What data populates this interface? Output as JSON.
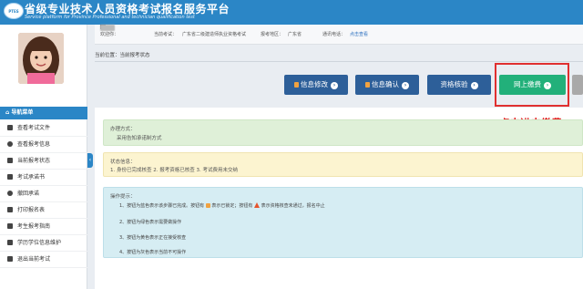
{
  "header": {
    "logo_text": "PTES",
    "title": "省级专业技术人员资格考试报名服务平台",
    "subtitle": "Service platform for Province Professional and technician qualification test"
  },
  "infobar": {
    "welcome": "欢迎你：",
    "current_exam_label": "当前考试：",
    "current_exam": "广东省二级建造师执业资格考试",
    "region_label": "报考地区：",
    "region": "广东省",
    "notice_label": "通讯电话：",
    "notice_link": "点击查看"
  },
  "sidebar": {
    "nav_title": "导航菜单",
    "items": [
      "查看考试文件",
      "查看报考信息",
      "当前报考状态",
      "考试承诺书",
      "撤回承诺",
      "打印报名表",
      "考生报考指南",
      "学历学位信息维护",
      "退出当前考试"
    ]
  },
  "breadcrumb": "当前位置：当前报考状态",
  "actions": {
    "modify": "信息修改",
    "confirm": "信息确认",
    "verify": "资格核验",
    "pay": "网上缴费"
  },
  "annotation": "点击进去缴费",
  "method_box": {
    "title": "办理方式：",
    "content": "采用告知承诺制方式"
  },
  "status_box": {
    "title": "状态信息：",
    "content": "1. 身份已完成核查 2. 报考资格已核查 3. 考试费用未交纳"
  },
  "tips_box": {
    "title": "操作提示：",
    "tips": [
      "1、按钮为蓝色表示该步骤已完成。按钮有",
      "表示已锁定；按钮有",
      "表示资格核查未通过，报名中止",
      "2、按钮为绿色表示需要做操作",
      "3、按钮为黄色表示正在接受核查",
      "4、按钮为灰色表示当前不可操作"
    ]
  },
  "colors": {
    "header": "#2b86c6",
    "done_button": "#2d5f99",
    "active_button": "#22b07a",
    "disabled_button": "#a9a9a9",
    "annotation": "#e21b1b"
  }
}
